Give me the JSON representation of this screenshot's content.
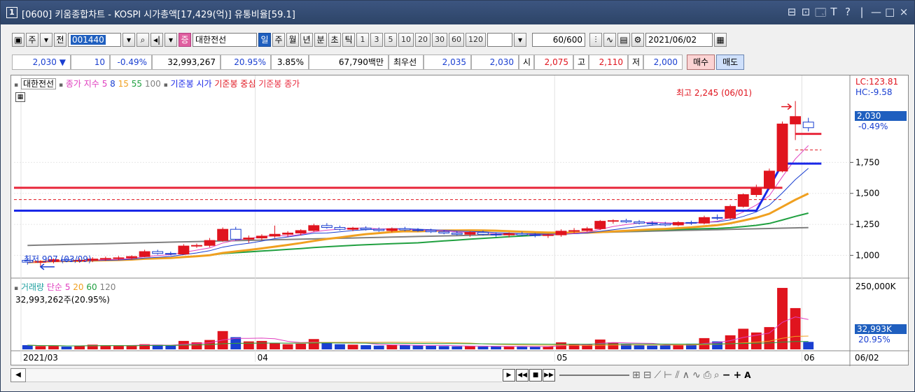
{
  "window": {
    "number": "1",
    "title": "[0600] 키움종합차트 - KOSPI 시가총액[17,429(억)] 유통비율[59.1]",
    "controls": [
      "⊟",
      "⊡",
      "🗔",
      "T",
      "?",
      "|",
      "—",
      "□",
      "×"
    ]
  },
  "toolbar": {
    "stock_type": "주",
    "jeon": "전",
    "code": "001440",
    "stock_badge": "증",
    "stock_name": "대한전선",
    "periods": [
      "일",
      "주",
      "월",
      "년",
      "분",
      "초",
      "틱"
    ],
    "selected_period": "일",
    "intervals": [
      "1",
      "3",
      "5",
      "10",
      "20",
      "30",
      "60",
      "120"
    ],
    "count": "60",
    "count_total": "/600",
    "date": "2021/06/02"
  },
  "quote": {
    "price": "2,030",
    "change_dir": "▼",
    "change": "10",
    "change_pct": "-0.49%",
    "volume": "32,993,267",
    "vol_ratio": "20.95%",
    "turnover": "3.85%",
    "amount": "67,790백만",
    "best_label": "최우선",
    "best_ask": "2,035",
    "best_bid": "2,030",
    "open_label": "시",
    "open": "2,075",
    "high_label": "고",
    "high": "2,110",
    "low_label": "저",
    "low": "2,000",
    "buy": "매수",
    "sell": "매도"
  },
  "legend": {
    "name": "대한전선",
    "ma_label": "종가 지수",
    "ma": [
      "5",
      "8",
      "15",
      "55",
      "100"
    ],
    "ref_open": "기준봉 시가",
    "ref_mid": "기준봉 중심",
    "ref_close": "기준봉 종가",
    "vol_label": "거래량",
    "vol_simple": "단순",
    "vol_ma": [
      "5",
      "20",
      "60",
      "120"
    ],
    "vol_value": "32,993,262주(20.95%)"
  },
  "annotations": {
    "high": "최고 2,245 (06/01)",
    "low": "최저 907 (03/09)",
    "lc": "LC:123.81",
    "hc": "HC:-9.58",
    "last_price": "2,030",
    "last_pct": "-0.49%",
    "vol_last": "32,993K",
    "vol_pct": "20.95%",
    "vol_axis_top": "250,000K"
  },
  "colors": {
    "up": "#e0141e",
    "down": "#1a3fd1",
    "ref_open": "#1a28e8",
    "ref_mid": "#e0141e",
    "ref_close": "#e8283c",
    "ma5": "#e040c0",
    "ma8": "#1a3fd1",
    "ma15": "#f0a020",
    "ma55": "#20a040",
    "ma100": "#808080"
  },
  "chart_data": {
    "type": "candlestick",
    "y_ticks": [
      "1,750",
      "1,500",
      "1,250",
      "1,000"
    ],
    "y_range": [
      850,
      2350
    ],
    "vol_range": [
      0,
      280
    ],
    "x_labels": [
      {
        "label": "2021/03",
        "index": 0
      },
      {
        "label": "04",
        "index": 18
      },
      {
        "label": "05",
        "index": 41
      },
      {
        "label": "06",
        "index": 60
      },
      {
        "label": "06/02",
        "index": 61
      }
    ],
    "ref_lines": {
      "open": 1360,
      "mid": 1450,
      "close": 1545
    },
    "candles": [
      {
        "o": 960,
        "h": 975,
        "l": 925,
        "c": 945,
        "v": 18
      },
      {
        "o": 945,
        "h": 960,
        "l": 907,
        "c": 950,
        "v": 14
      },
      {
        "o": 950,
        "h": 975,
        "l": 935,
        "c": 965,
        "v": 16
      },
      {
        "o": 965,
        "h": 980,
        "l": 945,
        "c": 955,
        "v": 12
      },
      {
        "o": 955,
        "h": 975,
        "l": 940,
        "c": 960,
        "v": 14
      },
      {
        "o": 960,
        "h": 985,
        "l": 945,
        "c": 970,
        "v": 20
      },
      {
        "o": 970,
        "h": 990,
        "l": 955,
        "c": 975,
        "v": 18
      },
      {
        "o": 975,
        "h": 995,
        "l": 960,
        "c": 980,
        "v": 16
      },
      {
        "o": 980,
        "h": 1000,
        "l": 965,
        "c": 990,
        "v": 15
      },
      {
        "o": 990,
        "h": 1045,
        "l": 985,
        "c": 1030,
        "v": 22
      },
      {
        "o": 1030,
        "h": 1045,
        "l": 1005,
        "c": 1015,
        "v": 20
      },
      {
        "o": 1015,
        "h": 1030,
        "l": 1000,
        "c": 1010,
        "v": 16
      },
      {
        "o": 1010,
        "h": 1090,
        "l": 1005,
        "c": 1075,
        "v": 36
      },
      {
        "o": 1075,
        "h": 1095,
        "l": 1060,
        "c": 1080,
        "v": 30
      },
      {
        "o": 1080,
        "h": 1140,
        "l": 1065,
        "c": 1120,
        "v": 40
      },
      {
        "o": 1120,
        "h": 1225,
        "l": 1110,
        "c": 1210,
        "v": 78
      },
      {
        "o": 1210,
        "h": 1230,
        "l": 1120,
        "c": 1130,
        "v": 52
      },
      {
        "o": 1130,
        "h": 1160,
        "l": 1100,
        "c": 1140,
        "v": 34
      },
      {
        "o": 1140,
        "h": 1170,
        "l": 1120,
        "c": 1155,
        "v": 36
      },
      {
        "o": 1155,
        "h": 1240,
        "l": 1140,
        "c": 1170,
        "v": 28
      },
      {
        "o": 1170,
        "h": 1195,
        "l": 1150,
        "c": 1180,
        "v": 22
      },
      {
        "o": 1180,
        "h": 1210,
        "l": 1160,
        "c": 1200,
        "v": 24
      },
      {
        "o": 1200,
        "h": 1255,
        "l": 1190,
        "c": 1240,
        "v": 44
      },
      {
        "o": 1240,
        "h": 1260,
        "l": 1215,
        "c": 1225,
        "v": 30
      },
      {
        "o": 1225,
        "h": 1240,
        "l": 1200,
        "c": 1210,
        "v": 22
      },
      {
        "o": 1210,
        "h": 1230,
        "l": 1195,
        "c": 1220,
        "v": 20
      },
      {
        "o": 1220,
        "h": 1235,
        "l": 1200,
        "c": 1210,
        "v": 18
      },
      {
        "o": 1210,
        "h": 1225,
        "l": 1190,
        "c": 1200,
        "v": 16
      },
      {
        "o": 1200,
        "h": 1225,
        "l": 1185,
        "c": 1215,
        "v": 20
      },
      {
        "o": 1215,
        "h": 1230,
        "l": 1195,
        "c": 1205,
        "v": 18
      },
      {
        "o": 1205,
        "h": 1220,
        "l": 1190,
        "c": 1200,
        "v": 16
      },
      {
        "o": 1200,
        "h": 1215,
        "l": 1180,
        "c": 1190,
        "v": 15
      },
      {
        "o": 1190,
        "h": 1205,
        "l": 1170,
        "c": 1180,
        "v": 14
      },
      {
        "o": 1180,
        "h": 1195,
        "l": 1160,
        "c": 1170,
        "v": 13
      },
      {
        "o": 1170,
        "h": 1195,
        "l": 1150,
        "c": 1185,
        "v": 14
      },
      {
        "o": 1185,
        "h": 1200,
        "l": 1160,
        "c": 1170,
        "v": 12
      },
      {
        "o": 1170,
        "h": 1185,
        "l": 1150,
        "c": 1165,
        "v": 12
      },
      {
        "o": 1165,
        "h": 1185,
        "l": 1145,
        "c": 1175,
        "v": 13
      },
      {
        "o": 1175,
        "h": 1190,
        "l": 1155,
        "c": 1165,
        "v": 12
      },
      {
        "o": 1165,
        "h": 1180,
        "l": 1145,
        "c": 1160,
        "v": 11
      },
      {
        "o": 1160,
        "h": 1175,
        "l": 1140,
        "c": 1165,
        "v": 12
      },
      {
        "o": 1165,
        "h": 1210,
        "l": 1150,
        "c": 1195,
        "v": 30
      },
      {
        "o": 1195,
        "h": 1220,
        "l": 1180,
        "c": 1200,
        "v": 24
      },
      {
        "o": 1200,
        "h": 1230,
        "l": 1190,
        "c": 1215,
        "v": 20
      },
      {
        "o": 1215,
        "h": 1285,
        "l": 1205,
        "c": 1275,
        "v": 42
      },
      {
        "o": 1275,
        "h": 1290,
        "l": 1255,
        "c": 1280,
        "v": 30
      },
      {
        "o": 1280,
        "h": 1295,
        "l": 1260,
        "c": 1270,
        "v": 22
      },
      {
        "o": 1270,
        "h": 1285,
        "l": 1250,
        "c": 1260,
        "v": 18
      },
      {
        "o": 1260,
        "h": 1275,
        "l": 1240,
        "c": 1255,
        "v": 16
      },
      {
        "o": 1255,
        "h": 1270,
        "l": 1235,
        "c": 1245,
        "v": 18
      },
      {
        "o": 1245,
        "h": 1275,
        "l": 1235,
        "c": 1265,
        "v": 20
      },
      {
        "o": 1265,
        "h": 1280,
        "l": 1245,
        "c": 1260,
        "v": 24
      },
      {
        "o": 1260,
        "h": 1320,
        "l": 1250,
        "c": 1305,
        "v": 48
      },
      {
        "o": 1305,
        "h": 1330,
        "l": 1285,
        "c": 1300,
        "v": 34
      },
      {
        "o": 1300,
        "h": 1410,
        "l": 1290,
        "c": 1395,
        "v": 60
      },
      {
        "o": 1395,
        "h": 1500,
        "l": 1385,
        "c": 1490,
        "v": 88
      },
      {
        "o": 1490,
        "h": 1570,
        "l": 1470,
        "c": 1540,
        "v": 72
      },
      {
        "o": 1540,
        "h": 1700,
        "l": 1530,
        "c": 1680,
        "v": 95
      },
      {
        "o": 1680,
        "h": 2080,
        "l": 1670,
        "c": 2060,
        "v": 262
      },
      {
        "o": 2060,
        "h": 2245,
        "l": 1930,
        "c": 2120,
        "v": 176
      },
      {
        "o": 2075,
        "h": 2110,
        "l": 2000,
        "c": 2030,
        "v": 32
      }
    ]
  }
}
